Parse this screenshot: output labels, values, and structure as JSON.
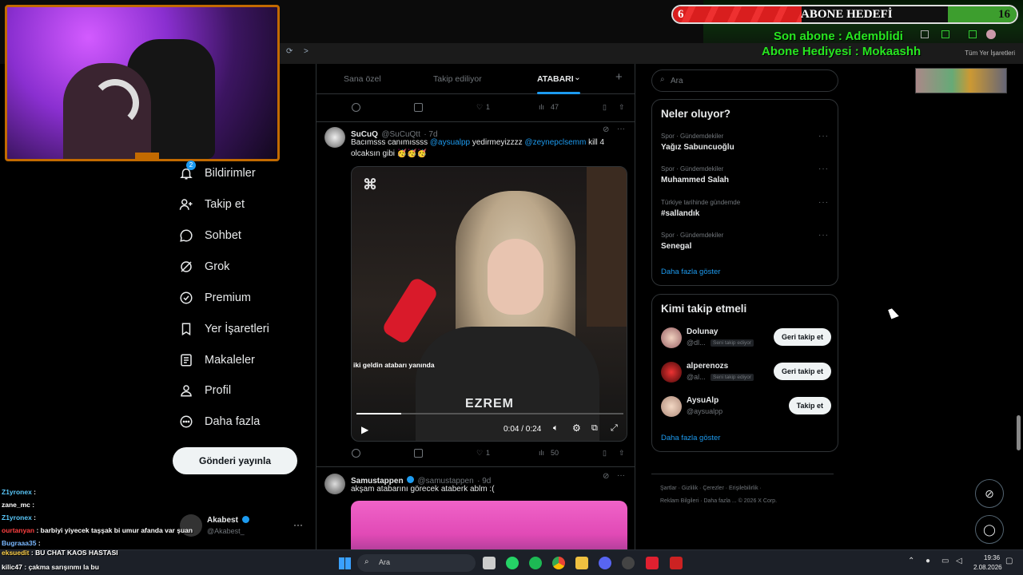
{
  "overlay": {
    "goal_title": "ABONE HEDEFİ",
    "goal_current": "6",
    "goal_target": "16",
    "goal_progress_fraction": 0.375,
    "last_sub": "Son abone : Ademblidi",
    "gift_sub": "Abone Hediyesi : Mokaashh",
    "bookmarks_label": "Tüm Yer İşaretleri"
  },
  "left_nav": {
    "items": [
      {
        "label": "Bildirimler",
        "icon": "bell-icon",
        "badge": "2"
      },
      {
        "label": "Takip et",
        "icon": "person-add-icon"
      },
      {
        "label": "Sohbet",
        "icon": "chat-bubble-icon"
      },
      {
        "label": "Grok",
        "icon": "grok-icon"
      },
      {
        "label": "Premium",
        "icon": "verified-icon"
      },
      {
        "label": "Yer İşaretleri",
        "icon": "bookmark-icon"
      },
      {
        "label": "Makaleler",
        "icon": "article-icon"
      },
      {
        "label": "Profil",
        "icon": "person-icon"
      },
      {
        "label": "Daha fazla",
        "icon": "more-circle-icon"
      }
    ],
    "post_button": "Gönderi yayınla",
    "account_name": "Akabest",
    "account_handle": "@Akabest_"
  },
  "feed": {
    "tabs": [
      "Sana özel",
      "Takip ediliyor",
      "ATABARI"
    ],
    "top_actions": {
      "likes": "1",
      "views": "47"
    },
    "tweet1": {
      "name": "SuCuQ",
      "handle": "@SuCuQtt",
      "time": "· 7d",
      "text_a": "Bacımsss canımıssss ",
      "mention1": "@aysualpp",
      "text_b": " yedirmeyizzzz ",
      "mention2": "@zeynepclsemm",
      "text_c": " kill 4",
      "text_d": "olcaksın gibi 🥳🥳🥳",
      "video_caption": "iki geldin atabarı yanında",
      "video_watermark": "EZREM",
      "video_time": "0:04 / 0:24",
      "video_progress_fraction": 0.167,
      "likes": "1",
      "views": "50"
    },
    "tweet2": {
      "name": "Samustappen",
      "handle": "@samustappen",
      "time": "· 9d",
      "text": "akşam atabarını görecek ataberk ablm :("
    }
  },
  "right": {
    "search_placeholder": "Ara",
    "trends_title": "Neler oluyor?",
    "trends": [
      {
        "category": "Spor · Gündemdekiler",
        "name": "Yağız Sabuncuoğlu"
      },
      {
        "category": "Spor · Gündemdekiler",
        "name": "Muhammed Salah"
      },
      {
        "category": "Türkiye tarihinde gündemde",
        "name": "#sallandık"
      },
      {
        "category": "Spor · Gündemdekiler",
        "name": "Senegal"
      }
    ],
    "trends_more": "Daha fazla göster",
    "follow_title": "Kimi takip etmeli",
    "follow": [
      {
        "name": "Dolunay",
        "handle": "@dl...",
        "badge": "Seni takip ediyor",
        "button": "Geri takip et"
      },
      {
        "name": "alperenozs",
        "handle": "@al...",
        "badge": "Seni takip ediyor",
        "button": "Geri takip et"
      },
      {
        "name": "AysuAlp",
        "handle": "@aysualpp",
        "badge": "",
        "button": "Takip et"
      }
    ],
    "follow_more": "Daha fazla göster",
    "footer1": [
      "Şartlar",
      "Gizlilik",
      "Çerezler",
      "Erişilebilirlik"
    ],
    "footer2": [
      "Reklam Bilgileri",
      "Daha fazla ...",
      "© 2026 X Corp."
    ]
  },
  "chat": [
    {
      "user": "Z1yronex",
      "msg": ":",
      "color": "#5ac8fa"
    },
    {
      "user": "zane_mc",
      "msg": ":",
      "color": "#ffffff"
    },
    {
      "user": "Z1yronex",
      "msg": ":",
      "color": "#5ac8fa"
    },
    {
      "user": "ourtanyan",
      "msg": ": barbiyi yiyecek taşşak bi umur afanda var şuan",
      "color": "#ff4040"
    },
    {
      "user": "Bugraaa35",
      "msg": ":",
      "color": "#7ab8ff"
    },
    {
      "user": "eksuedit",
      "msg": ": BU CHAT KAOS HASTASI",
      "color": "#ffd24a"
    },
    {
      "user": "kilic47",
      "msg": ": çakma sarışınmı la bu",
      "color": "#ffffff"
    }
  ],
  "taskbar": {
    "search_label": "Ara",
    "time": "19:36",
    "date": "2.08.2026"
  },
  "colors": {
    "accent": "#1d9bf0",
    "goal_red": "#d91e1e",
    "goal_green": "#3d9e2e",
    "overlay_green": "#27e620"
  }
}
